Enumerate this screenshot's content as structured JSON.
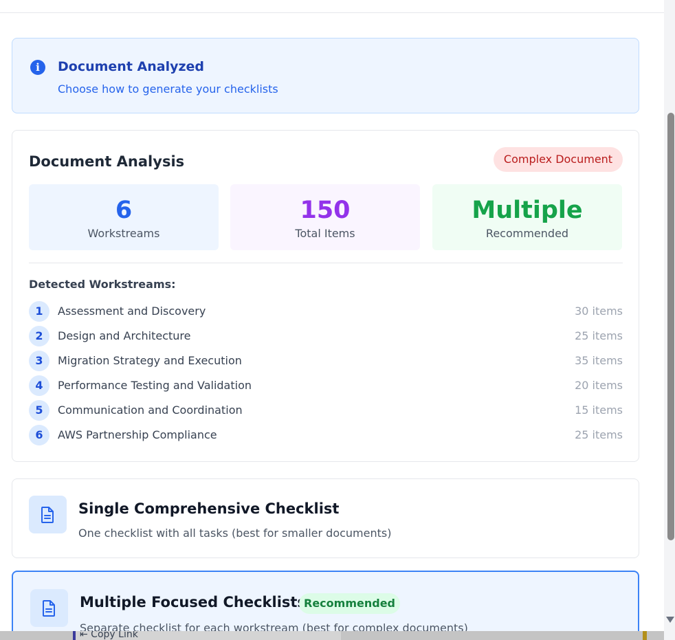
{
  "banner": {
    "icon": "info-icon",
    "icon_glyph": "i",
    "title": "Document Analyzed",
    "subtitle": "Choose how to generate your checklists"
  },
  "analysis": {
    "title": "Document Analysis",
    "badge": "Complex Document",
    "stats": [
      {
        "value": "6",
        "label": "Workstreams"
      },
      {
        "value": "150",
        "label": "Total Items"
      },
      {
        "value": "Multiple",
        "label": "Recommended"
      }
    ],
    "workstreams_heading": "Detected Workstreams:",
    "workstreams": [
      {
        "num": "1",
        "name": "Assessment and Discovery",
        "count": "30 items"
      },
      {
        "num": "2",
        "name": "Design and Architecture",
        "count": "25 items"
      },
      {
        "num": "3",
        "name": "Migration Strategy and Execution",
        "count": "35 items"
      },
      {
        "num": "4",
        "name": "Performance Testing and Validation",
        "count": "20 items"
      },
      {
        "num": "5",
        "name": "Communication and Coordination",
        "count": "15 items"
      },
      {
        "num": "6",
        "name": "AWS Partnership Compliance",
        "count": "25 items"
      }
    ]
  },
  "options": [
    {
      "icon": "document-icon",
      "title": "Single Comprehensive Checklist",
      "subtitle": "One checklist with all tasks (best for smaller documents)"
    },
    {
      "icon": "document-icon",
      "title": "Multiple Focused Checklists",
      "badge": "Recommended",
      "subtitle": "Separate checklist for each workstream (best for complex documents)"
    }
  ],
  "overlay": {
    "copy_link": "⇤ Copy Link"
  },
  "colors": {
    "accent": "#2563eb",
    "complex": "#b91c1c",
    "recommended": "#15803d",
    "purple": "#9333ea"
  }
}
